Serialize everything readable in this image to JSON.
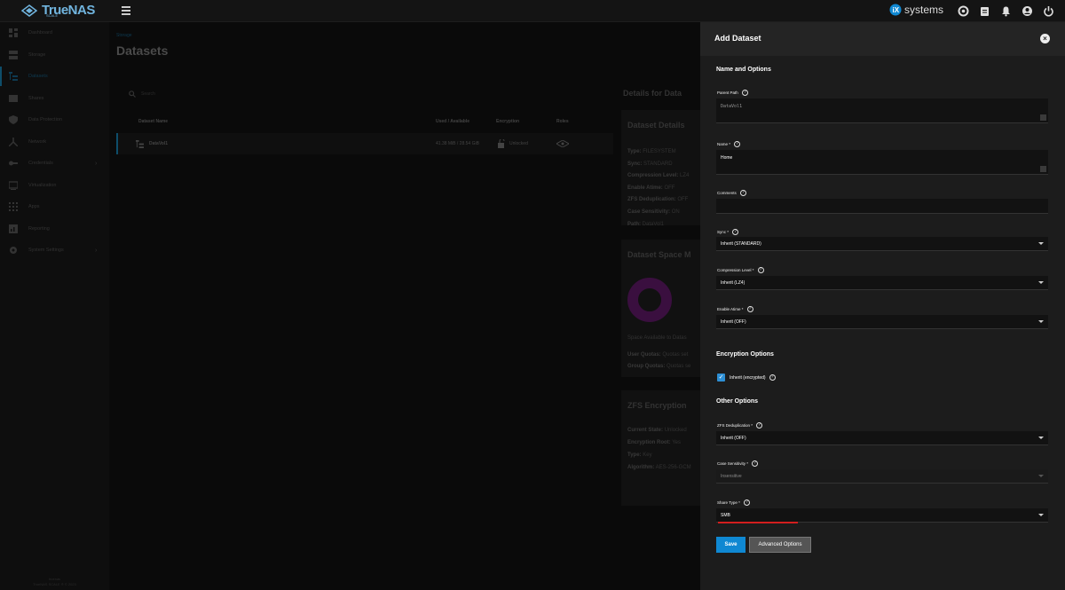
{
  "topbar": {
    "logo_text": "TrueNAS",
    "logo_sub": "SCALE",
    "ix_brand": "systems"
  },
  "sidebar": {
    "items": [
      {
        "label": "Dashboard",
        "icon": "dashboard-icon"
      },
      {
        "label": "Storage",
        "icon": "storage-icon"
      },
      {
        "label": "Datasets",
        "icon": "datasets-icon",
        "active": true
      },
      {
        "label": "Shares",
        "icon": "shares-icon"
      },
      {
        "label": "Data Protection",
        "icon": "shield-icon"
      },
      {
        "label": "Network",
        "icon": "network-icon"
      },
      {
        "label": "Credentials",
        "icon": "key-icon",
        "chevron": true
      },
      {
        "label": "Virtualization",
        "icon": "monitor-icon"
      },
      {
        "label": "Apps",
        "icon": "apps-icon"
      },
      {
        "label": "Reporting",
        "icon": "reporting-icon"
      },
      {
        "label": "System Settings",
        "icon": "gear-icon",
        "chevron": true
      }
    ],
    "footer_line1": "truenas",
    "footer_line2": "TrueNAS SCALE ® © 2023"
  },
  "main": {
    "breadcrumb": "Storage",
    "title": "Datasets",
    "search_placeholder": "Search",
    "table": {
      "headers": [
        "Dataset Name",
        "Used / Available",
        "Encryption",
        "Roles"
      ],
      "row": {
        "name": "DataVol1",
        "used": "41.38 MiB / 28.54 GiB",
        "encryption": "Unlocked"
      }
    },
    "details": {
      "title": "Details for  Data",
      "dataset_details": {
        "title": "Dataset Details",
        "items": [
          {
            "k": "Type:",
            "v": "FILESYSTEM"
          },
          {
            "k": "Sync:",
            "v": "STANDARD"
          },
          {
            "k": "Compression Level:",
            "v": "LZ4"
          },
          {
            "k": "Enable Atime:",
            "v": "OFF"
          },
          {
            "k": "ZFS Deduplication:",
            "v": "OFF"
          },
          {
            "k": "Case Sensitivity:",
            "v": "ON"
          },
          {
            "k": "Path:",
            "v": "DataVol1"
          }
        ]
      },
      "space": {
        "title": "Dataset Space M",
        "available": "Space Available to Datas",
        "user_quotas": "User Quotas:",
        "user_quotas_val": "Quotas set",
        "group_quotas": "Group Quotas:",
        "group_quotas_val": "Quotas se"
      },
      "encryption": {
        "title": "ZFS Encryption",
        "items": [
          {
            "k": "Current State:",
            "v": "Unlocked"
          },
          {
            "k": "Encryption Root:",
            "v": "Yes"
          },
          {
            "k": "Type:",
            "v": "Key"
          },
          {
            "k": "Algorithm:",
            "v": "AES-256-GCM"
          }
        ]
      }
    }
  },
  "panel": {
    "title": "Add Dataset",
    "section_name": "Name and Options",
    "parent_path_label": "Parent Path",
    "parent_path_value": "DataVol1",
    "name_label": "Name *",
    "name_value": "Home",
    "comments_label": "Comments",
    "sync_label": "Sync *",
    "sync_value": "Inherit (STANDARD)",
    "compression_label": "Compression Level *",
    "compression_value": "Inherit (LZ4)",
    "atime_label": "Enable Atime *",
    "atime_value": "Inherit (OFF)",
    "section_encryption": "Encryption Options",
    "inherit_encrypted_label": "Inherit (encrypted)",
    "section_other": "Other Options",
    "dedup_label": "ZFS Deduplication *",
    "dedup_value": "Inherit (OFF)",
    "case_label": "Case Sensitivity *",
    "case_value": "Insensitive",
    "share_label": "Share Type *",
    "share_value": "SMB",
    "save_label": "Save",
    "advanced_label": "Advanced Options",
    "help_glyph": "?"
  },
  "colors": {
    "accent": "#0f88d2",
    "logo": "#71b5df",
    "checkbox": "#2d8fd5",
    "highlight": "#d21e1e"
  }
}
